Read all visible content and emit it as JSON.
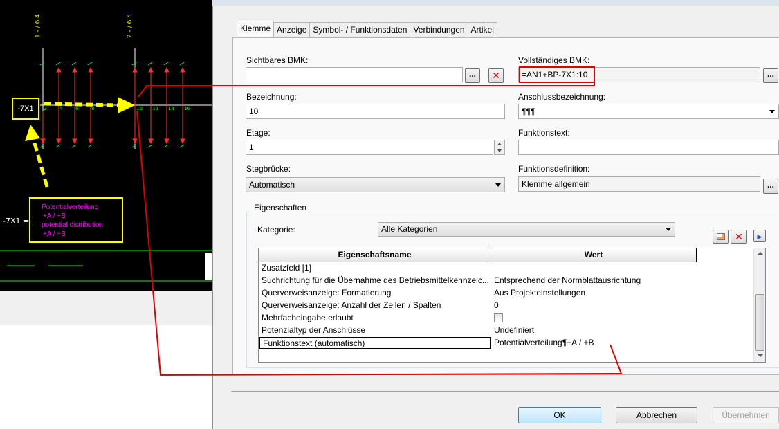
{
  "cad": {
    "terminal_ids": [
      "1 - / 6.4",
      "2 - / 6.5"
    ],
    "strip_label": "-7X1",
    "terminal_numbers_left": [
      "2",
      "4",
      "6",
      "8"
    ],
    "terminal_numbers_right": [
      "10",
      "12",
      "14",
      "16"
    ],
    "potential_prefix": "-7X1 =",
    "potential_lines": [
      "Potentialverteilung",
      "+A / +B",
      "potential distribution",
      "+A / +B"
    ],
    "colors": {
      "background": "#000000",
      "annotation": "#ffff00",
      "terminal_line": "#00ff00",
      "potential_text": "#ff00ff",
      "arrow": "#ff0000"
    }
  },
  "dialog": {
    "tabs": [
      {
        "label": "Klemme",
        "active": true
      },
      {
        "label": "Anzeige"
      },
      {
        "label": "Symbol- / Funktionsdaten"
      },
      {
        "label": "Verbindungen"
      },
      {
        "label": "Artikel"
      }
    ],
    "fields": {
      "sichtbares_bmk": {
        "label": "Sichtbares BMK:",
        "value": ""
      },
      "vollstaendiges_bmk": {
        "label": "Vollständiges BMK:",
        "value": "=AN1+BP-7X1:10"
      },
      "bezeichnung": {
        "label": "Bezeichnung:",
        "value": "10"
      },
      "anschlussbezeichnung": {
        "label": "Anschlussbezeichnung:",
        "value": "¶¶¶"
      },
      "etage": {
        "label": "Etage:",
        "value": "1"
      },
      "funktionstext": {
        "label": "Funktionstext:",
        "value": ""
      },
      "stegbruecke": {
        "label": "Stegbrücke:",
        "value": "Automatisch"
      },
      "funktionsdefinition": {
        "label": "Funktionsdefinition:",
        "value": "Klemme allgemein"
      }
    },
    "browse_label": "...",
    "eigenschaften": {
      "group_label": "Eigenschaften",
      "kategorie_label": "Kategorie:",
      "kategorie_value": "Alle Kategorien",
      "col_name": "Eigenschaftsname",
      "col_value": "Wert",
      "rows": [
        {
          "name": "Zusatzfeld [1]",
          "value": ""
        },
        {
          "name": "Suchrichtung für die Übernahme des Betriebsmittelkennzeic...",
          "value": "Entsprechend der Normblattausrichtung"
        },
        {
          "name": "Querverweisanzeige: Formatierung",
          "value": "Aus Projekteinstellungen"
        },
        {
          "name": "Querverweisanzeige: Anzahl der Zeilen / Spalten",
          "value": "0"
        },
        {
          "name": "Mehrfacheingabe erlaubt",
          "value": ""
        },
        {
          "name": "Potenzialtyp der Anschlüsse",
          "value": "Undefiniert"
        },
        {
          "name": "Funktionstext (automatisch)",
          "value": "Potentialverteilung¶+A / +B"
        }
      ]
    },
    "buttons": {
      "ok": "OK",
      "cancel": "Abbrechen",
      "apply": "Übernehmen"
    }
  }
}
